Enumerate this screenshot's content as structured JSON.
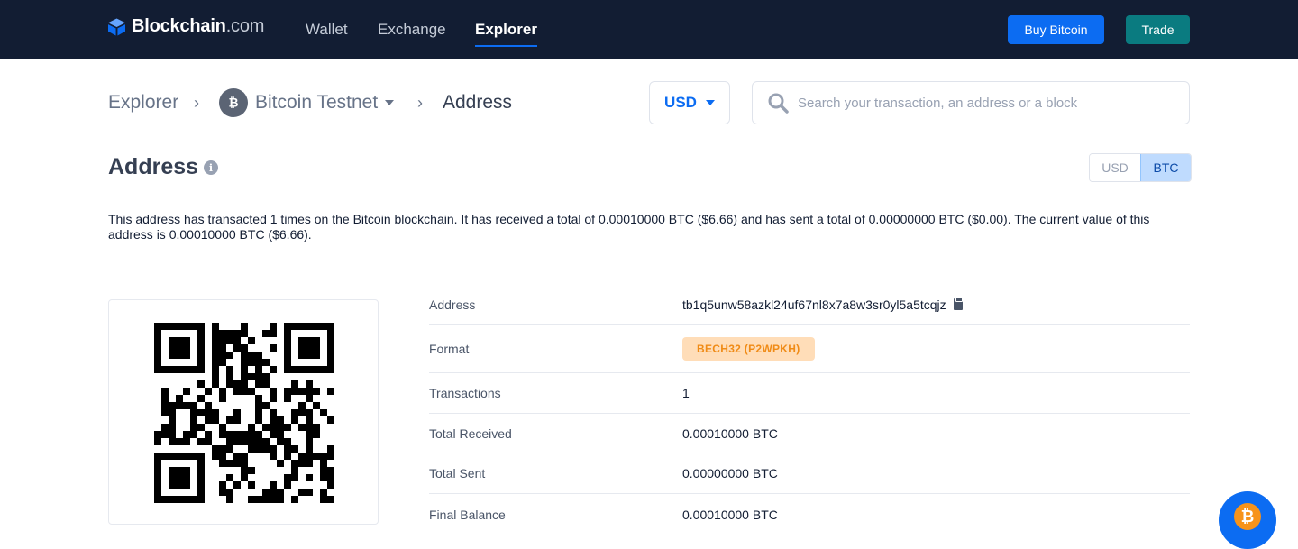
{
  "nav": {
    "logo_main": "Blockchain",
    "logo_suffix": ".com",
    "links": [
      "Wallet",
      "Exchange",
      "Explorer"
    ],
    "active_link": "Explorer",
    "buy_label": "Buy Bitcoin",
    "trade_label": "Trade",
    "colors": {
      "background": "#121d33",
      "buy": "#0c6cf2",
      "trade": "#0a7b80"
    }
  },
  "breadcrumb": {
    "root": "Explorer",
    "network": "Bitcoin Testnet",
    "current": "Address"
  },
  "currency_select": {
    "value": "USD"
  },
  "search": {
    "placeholder": "Search your transaction, an address or a block"
  },
  "page": {
    "title": "Address",
    "toggle": {
      "options": [
        "USD",
        "BTC"
      ],
      "selected": "BTC"
    },
    "summary": "This address has transacted 1 times on the Bitcoin blockchain. It has received a total of 0.00010000 BTC ($6.66) and has sent a total of 0.00000000 BTC ($0.00). The current value of this address is 0.00010000 BTC ($6.66)."
  },
  "details": [
    {
      "label": "Address",
      "value": "tb1q5unw58azkl24uf67nl8x7a8w3sr0yl5a5tcqjz",
      "kind": "copy"
    },
    {
      "label": "Format",
      "value": "BECH32 (P2WPKH)",
      "kind": "badge"
    },
    {
      "label": "Transactions",
      "value": "1",
      "kind": "text"
    },
    {
      "label": "Total Received",
      "value": "0.00010000 BTC",
      "kind": "text"
    },
    {
      "label": "Total Sent",
      "value": "0.00000000 BTC",
      "kind": "text"
    },
    {
      "label": "Final Balance",
      "value": "0.00010000 BTC",
      "kind": "text"
    }
  ],
  "icons": {
    "search": "search-icon",
    "info": "info-icon",
    "copy": "copy-icon",
    "bitcoin": "bitcoin-icon",
    "qr": "qr-code"
  }
}
